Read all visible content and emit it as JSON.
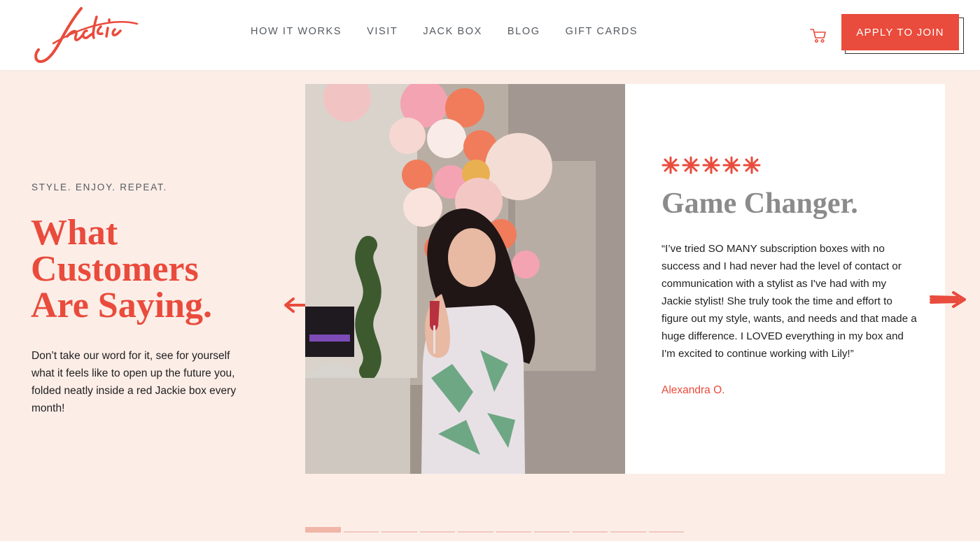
{
  "brand": {
    "logo_text": "Jackie",
    "accent": "#e94b3c",
    "page_bg": "#fcede7"
  },
  "nav": {
    "items": [
      "HOW IT WORKS",
      "VISIT",
      "JACK BOX",
      "BLOG",
      "GIFT CARDS"
    ]
  },
  "header": {
    "cart_icon": "shopping-cart-icon",
    "cta_label": "APPLY TO JOIN"
  },
  "hero": {
    "eyebrow": "STYLE. ENJOY. REPEAT.",
    "headline_lines": [
      "What",
      "Customers",
      "Are Saying."
    ],
    "intro": "Don’t take our word for it, see for yourself what it feels like to open up the future you, folded neatly inside a red Jackie box every month!"
  },
  "review": {
    "rating": 5,
    "title": "Game Changer.",
    "quote": "“I’ve tried SO MANY subscription boxes with no success and I had never had the level of contact or communication with a stylist as I've had with my Jackie stylist! She truly took the time and effort to figure out my style, wants, and needs and that made a huge difference. I LOVED everything in my box and I'm excited to continue working with Lily!”",
    "author": "Alexandra O.",
    "photo_desc": "customer-photo"
  },
  "carousel": {
    "slide_count": 10,
    "active_index": 0
  }
}
